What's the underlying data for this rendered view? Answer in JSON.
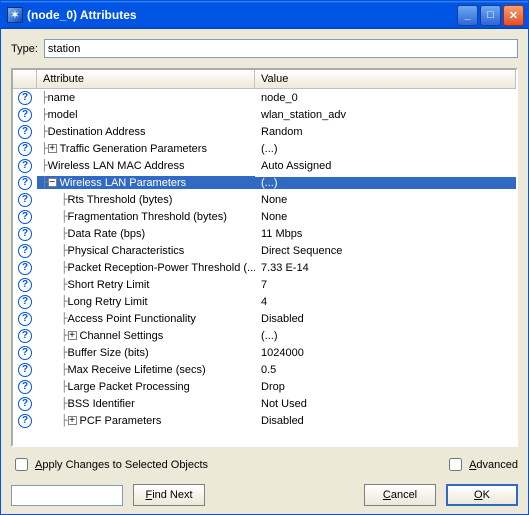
{
  "titlebar": {
    "title": "(node_0) Attributes"
  },
  "type": {
    "label": "Type:",
    "value": "station"
  },
  "grid": {
    "columns": {
      "attribute": "Attribute",
      "value": "Value"
    },
    "rows": [
      {
        "depth": 0,
        "expander": null,
        "label": "name",
        "value": "node_0",
        "selected": false
      },
      {
        "depth": 0,
        "expander": null,
        "label": "model",
        "value": "wlan_station_adv",
        "selected": false
      },
      {
        "depth": 0,
        "expander": null,
        "label": "Destination Address",
        "value": "Random",
        "selected": false
      },
      {
        "depth": 0,
        "expander": "plus",
        "label": "Traffic Generation Parameters",
        "value": "(...)",
        "selected": false
      },
      {
        "depth": 0,
        "expander": null,
        "label": "Wireless LAN MAC Address",
        "value": "Auto Assigned",
        "selected": false
      },
      {
        "depth": 0,
        "expander": "minus",
        "label": "Wireless LAN Parameters",
        "value": "(...)",
        "selected": true
      },
      {
        "depth": 1,
        "expander": null,
        "label": "Rts Threshold (bytes)",
        "value": "None",
        "selected": false
      },
      {
        "depth": 1,
        "expander": null,
        "label": "Fragmentation Threshold (bytes)",
        "value": "None",
        "selected": false
      },
      {
        "depth": 1,
        "expander": null,
        "label": "Data Rate (bps)",
        "value": "11 Mbps",
        "selected": false
      },
      {
        "depth": 1,
        "expander": null,
        "label": "Physical Characteristics",
        "value": "Direct Sequence",
        "selected": false
      },
      {
        "depth": 1,
        "expander": null,
        "label": "Packet Reception-Power Threshold (...",
        "value": "7.33 E-14",
        "selected": false
      },
      {
        "depth": 1,
        "expander": null,
        "label": "Short Retry Limit",
        "value": "7",
        "selected": false
      },
      {
        "depth": 1,
        "expander": null,
        "label": "Long Retry Limit",
        "value": "4",
        "selected": false
      },
      {
        "depth": 1,
        "expander": null,
        "label": "Access Point Functionality",
        "value": "Disabled",
        "selected": false
      },
      {
        "depth": 1,
        "expander": "plus",
        "label": "Channel Settings",
        "value": "(...)",
        "selected": false
      },
      {
        "depth": 1,
        "expander": null,
        "label": "Buffer Size (bits)",
        "value": "1024000",
        "selected": false
      },
      {
        "depth": 1,
        "expander": null,
        "label": "Max Receive Lifetime (secs)",
        "value": "0.5",
        "selected": false
      },
      {
        "depth": 1,
        "expander": null,
        "label": "Large Packet Processing",
        "value": "Drop",
        "selected": false
      },
      {
        "depth": 1,
        "expander": null,
        "label": "BSS Identifier",
        "value": "Not Used",
        "selected": false
      },
      {
        "depth": 1,
        "expander": "plus",
        "label": "PCF Parameters",
        "value": "Disabled",
        "selected": false
      }
    ]
  },
  "checks": {
    "apply": "pply Changes to Selected Objects",
    "apply_accel": "A",
    "advanced": "dvanced",
    "advanced_accel": "A"
  },
  "buttons": {
    "find_next": "ind Next",
    "find_next_accel": "F",
    "cancel": "ancel",
    "cancel_accel": "C",
    "ok": "K",
    "ok_accel": "O"
  }
}
